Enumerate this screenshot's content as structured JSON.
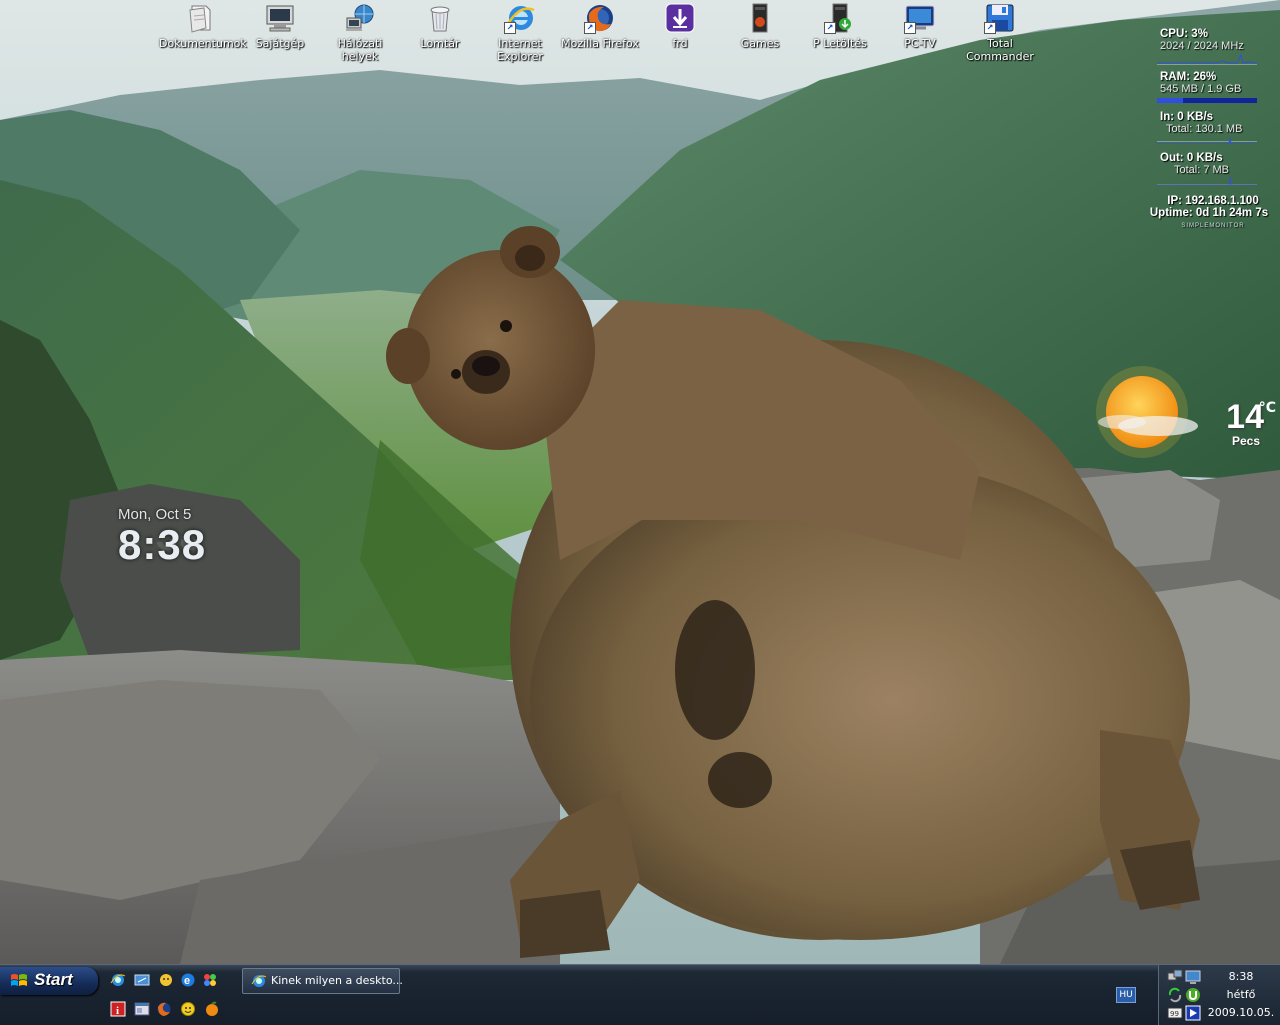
{
  "desktop": {
    "icons": [
      {
        "label": "Dokumentumok",
        "icon": "documents-icon",
        "shortcut": false
      },
      {
        "label": "Sajátgép",
        "icon": "my-computer-icon",
        "shortcut": false
      },
      {
        "label": "Hálózati helyek",
        "icon": "network-places-icon",
        "shortcut": false
      },
      {
        "label": "Lomtár",
        "icon": "recycle-bin-icon",
        "shortcut": false
      },
      {
        "label": "Internet Explorer",
        "icon": "internet-explorer-icon",
        "shortcut": true
      },
      {
        "label": "Mozilla Firefox",
        "icon": "firefox-icon",
        "shortcut": true
      },
      {
        "label": "frd",
        "icon": "download-folder-icon",
        "shortcut": false
      },
      {
        "label": "Games",
        "icon": "games-icon",
        "shortcut": false
      },
      {
        "label": "P Letöltés",
        "icon": "download-shortcut-icon",
        "shortcut": true
      },
      {
        "label": "PC-TV",
        "icon": "pc-tv-icon",
        "shortcut": true
      },
      {
        "label": "Total Commander",
        "icon": "total-commander-icon",
        "shortcut": true
      }
    ]
  },
  "monitor": {
    "cpu": "CPU: 3%",
    "cpu_freq": "2024 / 2024 MHz",
    "ram": "RAM: 26%",
    "ram_detail": "545 MB / 1.9 GB",
    "ram_fraction": 0.26,
    "net_in": "In: 0 KB/s",
    "net_in_total": "Total: 130.1 MB",
    "net_out": "Out: 0 KB/s",
    "net_out_total": "Total: 7 MB",
    "ip": "IP: 192.168.1.100",
    "uptime": "Uptime: 0d 1h 24m 7s",
    "brand": "SIMPLEMONITOR"
  },
  "weather": {
    "temp": "14",
    "unit": "°C",
    "city": "Pecs",
    "icon": "sun-partly-cloudy-icon"
  },
  "clock_widget": {
    "date": "Mon, Oct 5",
    "time": "8:38"
  },
  "taskbar": {
    "start_label": "Start",
    "quick_launch": [
      "ie-quick-icon",
      "show-desktop-icon",
      "msn-icon",
      "ie-e-icon",
      "media-icon",
      "info-icon",
      "window-icon",
      "firefox-small-icon",
      "smiley-icon",
      "orange-icon"
    ],
    "task_window": "Kinek milyen a deskto...",
    "language": "HU",
    "tray_time": "8:38",
    "tray_day": "hétfő",
    "tray_date": "2009.10.05."
  }
}
